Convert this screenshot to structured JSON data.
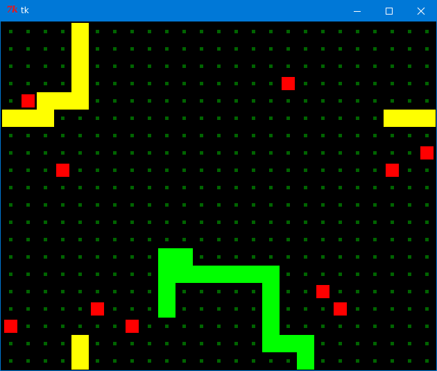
{
  "window": {
    "title": "tk",
    "icon": "tk-feather-icon",
    "controls": [
      "minimize-icon",
      "maximize-icon",
      "close-icon"
    ]
  },
  "board": {
    "cell_size": 25,
    "columns": 25,
    "rows": 20,
    "background_color": "#000000",
    "grid_dot_color": "#006400",
    "food_color": "#ff0000",
    "food": [
      [
        16,
        3
      ],
      [
        1,
        4
      ],
      [
        24,
        7
      ],
      [
        3,
        8
      ],
      [
        22,
        8
      ],
      [
        18,
        15
      ],
      [
        19,
        16
      ],
      [
        5,
        16
      ],
      [
        0,
        17
      ],
      [
        7,
        17
      ]
    ],
    "snakes": [
      {
        "color": "#ffff00",
        "cells": [
          [
            4,
            0
          ],
          [
            4,
            1
          ],
          [
            4,
            2
          ],
          [
            4,
            3
          ],
          [
            4,
            4
          ],
          [
            3,
            4
          ],
          [
            2,
            4
          ],
          [
            2,
            5
          ],
          [
            1,
            5
          ],
          [
            0,
            5
          ],
          [
            24,
            5
          ],
          [
            23,
            5
          ],
          [
            22,
            5
          ],
          [
            4,
            18
          ],
          [
            4,
            19
          ]
        ]
      },
      {
        "color": "#00ff00",
        "cells": [
          [
            9,
            16
          ],
          [
            9,
            15
          ],
          [
            9,
            14
          ],
          [
            9,
            13
          ],
          [
            10,
            13
          ],
          [
            10,
            14
          ],
          [
            11,
            14
          ],
          [
            12,
            14
          ],
          [
            13,
            14
          ],
          [
            14,
            14
          ],
          [
            15,
            14
          ],
          [
            15,
            15
          ],
          [
            15,
            16
          ],
          [
            15,
            17
          ],
          [
            15,
            18
          ],
          [
            16,
            18
          ],
          [
            17,
            18
          ],
          [
            17,
            19
          ]
        ]
      }
    ]
  }
}
